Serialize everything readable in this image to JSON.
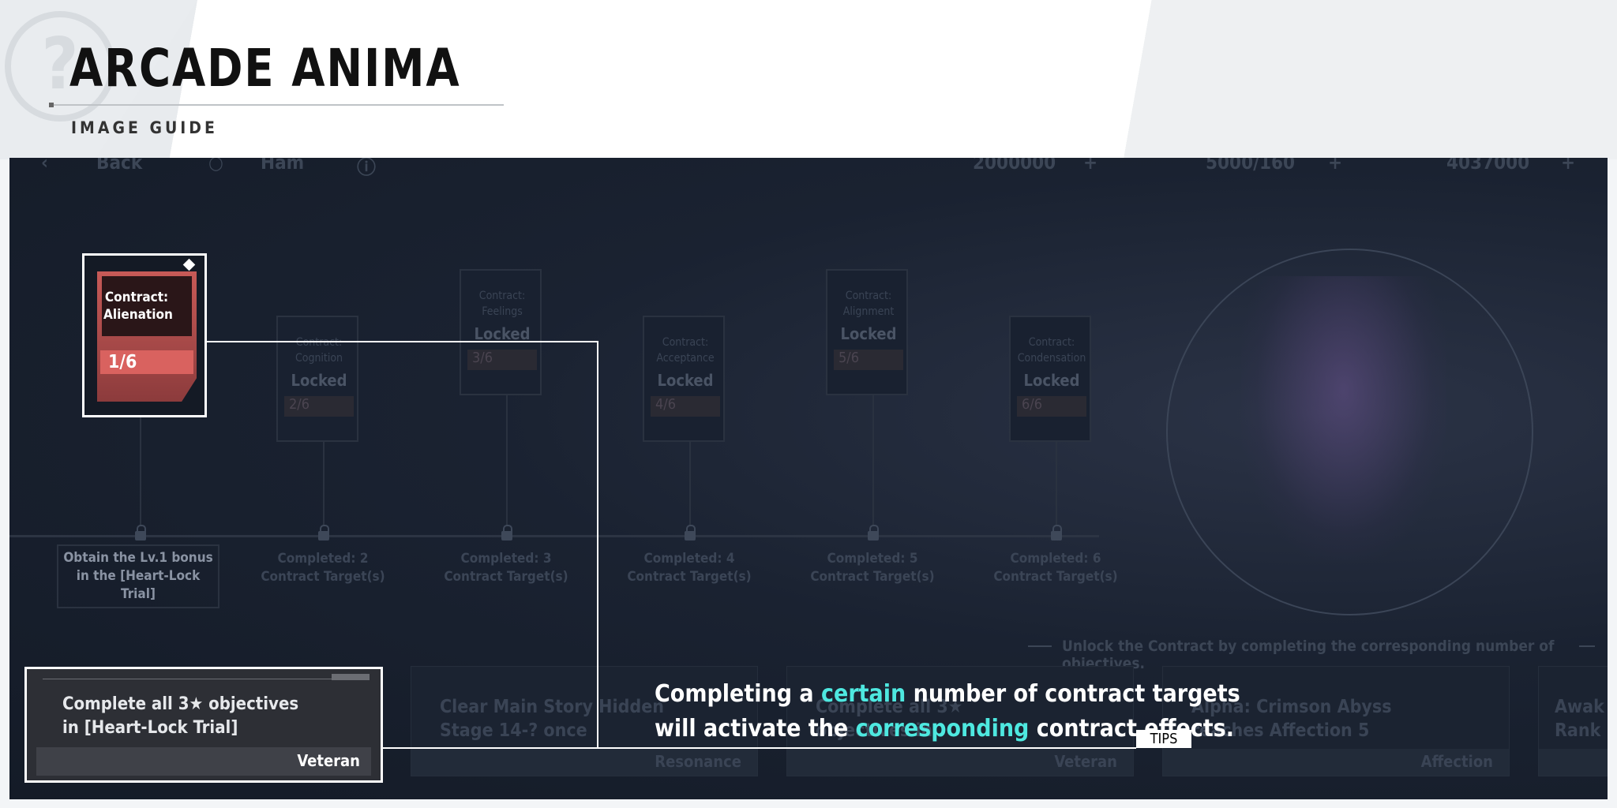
{
  "header": {
    "title": "ARCADE ANIMA",
    "subtitle": "IMAGE GUIDE"
  },
  "topbar": {
    "back": "Back",
    "char": "Ham",
    "gold": "2000000",
    "stamina": "5000/160",
    "gems": "4037000"
  },
  "contracts": [
    {
      "name": "Contract: Alienation",
      "progress": "1/6",
      "status": ""
    },
    {
      "name": "Contract: Cognition",
      "progress": "2/6",
      "status": "Locked"
    },
    {
      "name": "Contract: Feelings",
      "progress": "3/6",
      "status": "Locked"
    },
    {
      "name": "Contract: Acceptance",
      "progress": "4/6",
      "status": "Locked"
    },
    {
      "name": "Contract: Alignment",
      "progress": "5/6",
      "status": "Locked"
    },
    {
      "name": "Contract: Condensation",
      "progress": "6/6",
      "status": "Locked"
    }
  ],
  "milestones": [
    "Obtain the Lv.1 bonus in the [Heart-Lock Trial]",
    "Completed: 2 Contract Target(s)",
    "Completed: 3 Contract Target(s)",
    "Completed: 4 Contract Target(s)",
    "Completed: 5 Contract Target(s)",
    "Completed: 6 Contract Target(s)"
  ],
  "hint": "Unlock the Contract by completing the corresponding number of objectives.",
  "objectives": [
    {
      "text": "Complete all 3★ objectives in [Heart-Lock Trial]",
      "tag": "Veteran"
    },
    {
      "text": "Clear Main Story Hidden Stage 14-? once",
      "tag": "Resonance"
    },
    {
      "text": "Complete all 3★ objectives in",
      "tag": "Veteran"
    },
    {
      "text": "Alpha: Crimson Abyss reaches Affection 5",
      "tag": "Affection"
    },
    {
      "text": "Awak Rank",
      "tag": ""
    }
  ],
  "description": {
    "l1a": "Completing a ",
    "l1b": "certain",
    "l1c": " number of contract targets",
    "l2a": "will activate the ",
    "l2b": "corresponding",
    "l2c": " contract effects."
  },
  "tips": "TIPS",
  "colors": {
    "highlight": "#4ee8e0",
    "card": "#d9625f"
  }
}
